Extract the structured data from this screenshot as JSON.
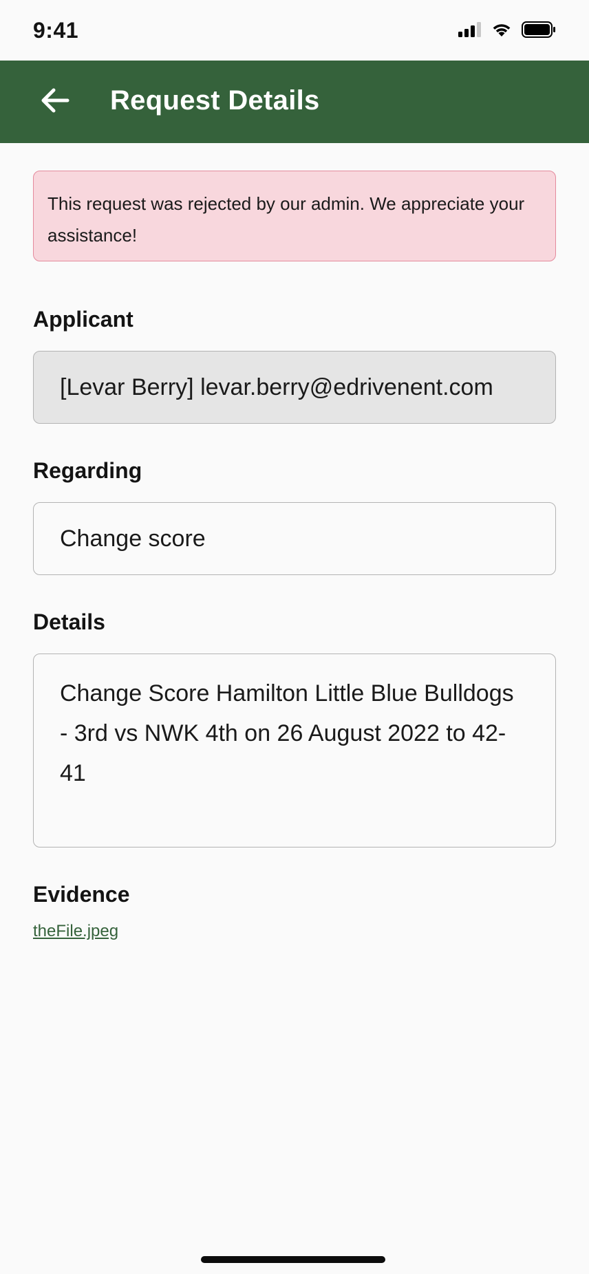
{
  "status_bar": {
    "time": "9:41"
  },
  "app_bar": {
    "back_icon": "arrow-left-icon",
    "title": "Request Details"
  },
  "alert": {
    "message": "This request was rejected by our admin. We appreciate your assistance!",
    "background_color": "#f8d7dd",
    "border_color": "#e48a9c"
  },
  "applicant": {
    "label": "Applicant",
    "value": "[Levar Berry] levar.berry@edrivenent.com"
  },
  "regarding": {
    "label": "Regarding",
    "value": "Change score"
  },
  "details": {
    "label": "Details",
    "value": "Change Score Hamilton Little Blue Bulldogs - 3rd vs NWK 4th on 26 August 2022 to 42-41"
  },
  "evidence": {
    "label": "Evidence",
    "file_name": "theFile.jpeg"
  },
  "colors": {
    "brand": "#35623b",
    "background": "#fafafa",
    "readonly_field": "#e5e5e5"
  }
}
